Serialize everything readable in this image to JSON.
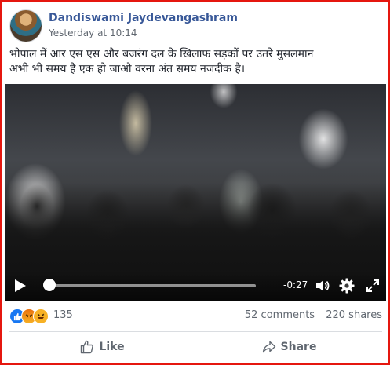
{
  "post": {
    "author": "Dandiswami Jaydevangashram",
    "timestamp": "Yesterday at 10:14",
    "text_line1": "भोपाल में आर एस एस और बजरंग दल के खिलाफ सड़कों पर उतरे मुसलमान",
    "text_line2": "अभी भी समय है एक हो जाओ वरना अंत समय नजदीक है।"
  },
  "video": {
    "time_remaining": "-0:27",
    "progress": 0.03
  },
  "reactions": {
    "icons": [
      "like-icon",
      "angry-icon",
      "haha-icon"
    ],
    "count": "135",
    "comments": "52 comments",
    "shares": "220 shares"
  },
  "actions": {
    "like_label": "Like",
    "share_label": "Share"
  },
  "colors": {
    "frame_border": "#e5170f",
    "author_link": "#385898",
    "meta_text": "#606770",
    "like_blue": "#1877f2"
  }
}
